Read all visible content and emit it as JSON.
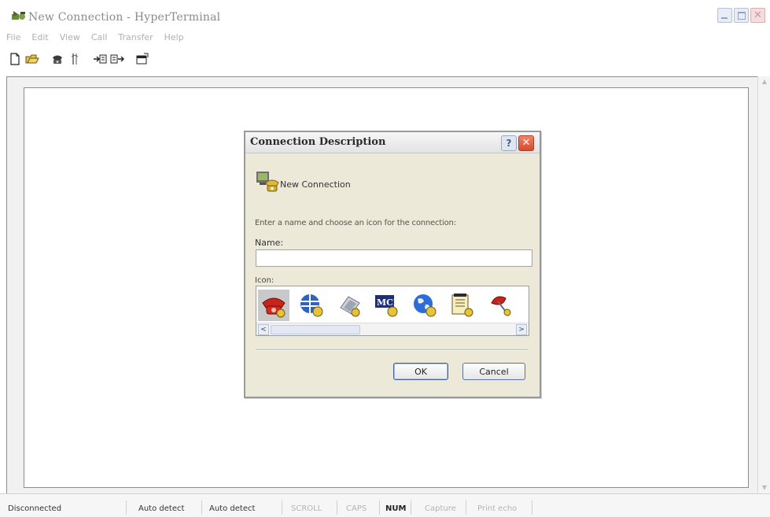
{
  "window": {
    "title": "New Connection - HyperTerminal",
    "app_icon": "hyperterminal-phone-icon"
  },
  "menu": {
    "items": [
      "File",
      "Edit",
      "View",
      "Call",
      "Transfer",
      "Help"
    ]
  },
  "toolbar": {
    "icons": [
      "new-document-icon",
      "open-folder-icon",
      "connect-phone-icon",
      "disconnect-icon",
      "send-icon",
      "receive-icon",
      "properties-icon"
    ]
  },
  "dialog": {
    "title": "Connection Description",
    "help_label": "?",
    "close_label": "✕",
    "connection_name": "New Connection",
    "instruction": "Enter a name and choose an icon for the connection:",
    "name_label": "Name:",
    "name_value": "",
    "icon_label": "Icon:",
    "icons": [
      "red-phone-icon",
      "globe-modem-icon",
      "fax-phone-icon",
      "mci-icon",
      "blue-globe-icon",
      "notepad-icon",
      "red-satellite-icon"
    ],
    "selected_icon_index": 0,
    "ok_label": "OK",
    "cancel_label": "Cancel"
  },
  "statusbar": {
    "connection": "Disconnected",
    "detect1": "Auto detect",
    "detect2": "Auto detect",
    "scroll": "SCROLL",
    "caps": "CAPS",
    "num": "NUM",
    "capture": "Capture",
    "print_echo": "Print echo"
  }
}
